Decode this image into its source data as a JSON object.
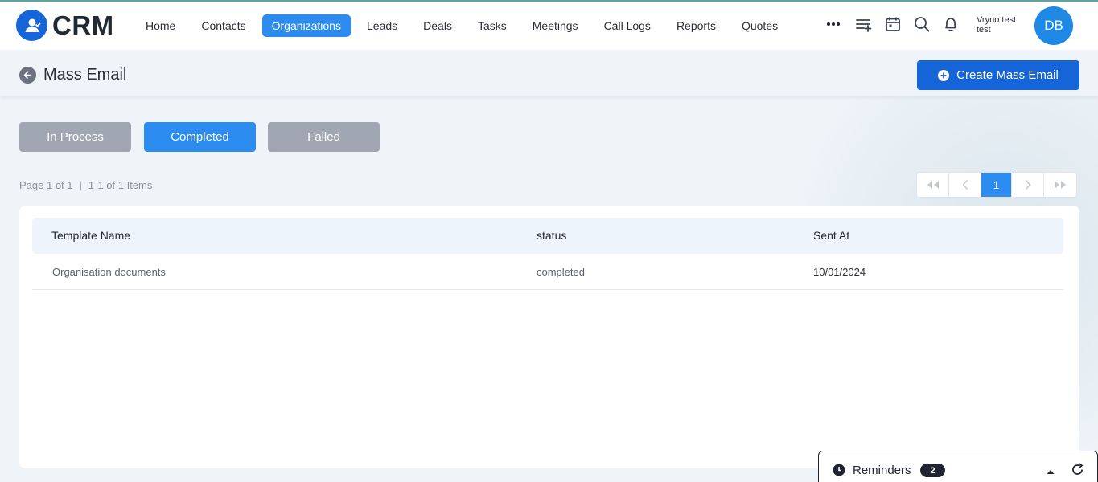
{
  "app": {
    "logo_text": "CRM",
    "accent_color": "#1565d8"
  },
  "nav": {
    "items": [
      {
        "label": "Home",
        "active": false
      },
      {
        "label": "Contacts",
        "active": false
      },
      {
        "label": "Organizations",
        "active": true
      },
      {
        "label": "Leads",
        "active": false
      },
      {
        "label": "Deals",
        "active": false
      },
      {
        "label": "Tasks",
        "active": false
      },
      {
        "label": "Meetings",
        "active": false
      },
      {
        "label": "Call Logs",
        "active": false
      },
      {
        "label": "Reports",
        "active": false
      },
      {
        "label": "Quotes",
        "active": false
      }
    ],
    "icons": [
      "more-icon",
      "add-list-icon",
      "calendar-icon",
      "search-icon",
      "bell-icon"
    ],
    "user_name": "Vryno test test",
    "avatar_initials": "DB"
  },
  "header": {
    "title": "Mass Email",
    "create_button": "Create Mass Email"
  },
  "status_tabs": [
    {
      "label": "In Process",
      "active": false
    },
    {
      "label": "Completed",
      "active": true
    },
    {
      "label": "Failed",
      "active": false
    }
  ],
  "pagination": {
    "page_text": "Page 1 of 1",
    "separator": "|",
    "items_text": "1-1 of 1 Items",
    "current_page": "1"
  },
  "table": {
    "columns": [
      "Template Name",
      "status",
      "Sent At"
    ],
    "rows": [
      {
        "template_name": "Organisation documents",
        "status": "completed",
        "sent_at": "10/01/2024"
      }
    ]
  },
  "reminders": {
    "label": "Reminders",
    "count": "2"
  }
}
